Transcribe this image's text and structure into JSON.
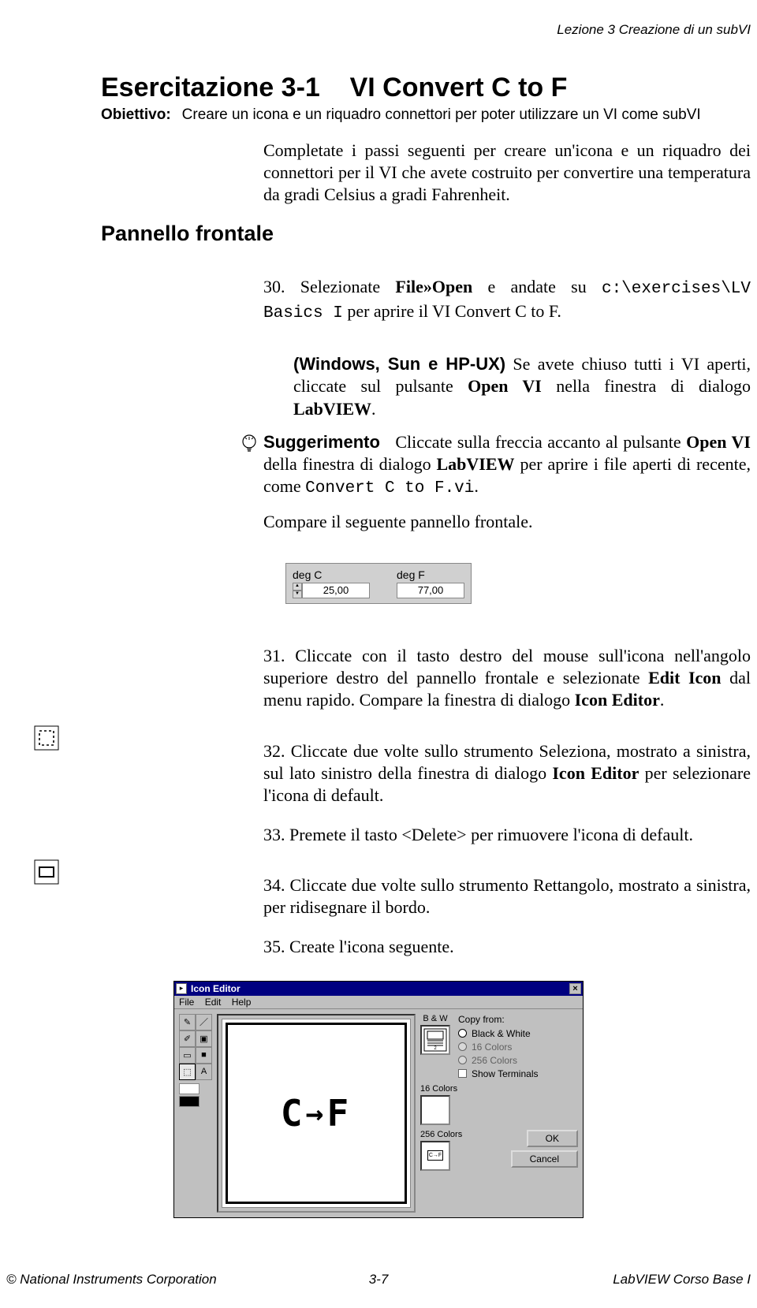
{
  "header": {
    "right": "Lezione 3     Creazione di un subVI"
  },
  "title": {
    "ex": "Esercitazione 3-1",
    "name": "VI Convert C to F"
  },
  "objective": {
    "label": "Obiettivo:",
    "text": "Creare un icona e un riquadro connettori per poter utilizzare un VI come subVI"
  },
  "intro": "Completate i passi seguenti per creare un'icona e un riquadro dei connettori per il VI che avete costruito per convertire una temperatura da gradi Celsius a gradi Fahrenheit.",
  "section_heading": "Pannello frontale",
  "step30": {
    "num": "30.",
    "pre": "Selezionate ",
    "menu": "File»Open",
    "mid": " e andate su ",
    "path": "c:\\exercises\\LV Basics I",
    "post": " per aprire il VI Convert C to F."
  },
  "windows_note": {
    "lead": "(Windows, Sun e HP-UX)",
    "body_pre": " Se avete chiuso tutti i VI aperti, cliccate sul pulsante ",
    "btn": "Open VI",
    "body_mid": " nella finestra di dialogo ",
    "dlg": "LabVIEW",
    "body_post": "."
  },
  "tip": {
    "label": "Suggerimento",
    "body_pre": "Cliccate sulla freccia accanto al pulsante ",
    "btn": "Open VI",
    "body_mid": " della finestra di dialogo ",
    "dlg": "LabVIEW",
    "body_mid2": " per aprire i file aperti di recente, come ",
    "file": "Convert C to F.vi",
    "body_post": "."
  },
  "appears": "Compare il seguente pannello frontale.",
  "panel": {
    "label_c": "deg C",
    "label_f": "deg F",
    "val_c": "25,00",
    "val_f": "77,00"
  },
  "step31": {
    "num": "31.",
    "pre": "Cliccate con il tasto destro del mouse sull'icona nell'angolo superiore destro del pannello frontale e selezionate ",
    "menu": "Edit Icon",
    "mid": " dal menu rapido. Compare la finestra di dialogo ",
    "dlg": "Icon Editor",
    "post": "."
  },
  "step32": {
    "num": "32.",
    "pre": "Cliccate due volte sullo strumento Seleziona, mostrato a sinistra, sul lato sinistro della finestra di dialogo ",
    "dlg": "Icon Editor",
    "post": " per selezionare l'icona di default."
  },
  "step33": {
    "num": "33.",
    "text": "Premete il tasto <Delete> per rimuovere l'icona di default."
  },
  "step34": {
    "num": "34.",
    "text": "Cliccate due volte sullo strumento Rettangolo, mostrato a sinistra, per ridisegnare il bordo."
  },
  "step35": {
    "num": "35.",
    "text": "Create l'icona seguente."
  },
  "dialog": {
    "title": "Icon Editor",
    "menu": {
      "file": "File",
      "edit": "Edit",
      "help": "Help"
    },
    "canvas_label": "C→F",
    "previews": {
      "bw": "B & W",
      "c16": "16 Colors",
      "c256": "256 Colors",
      "small_text": "C→F"
    },
    "copy_from": {
      "title": "Copy from:",
      "bw": "Black & White",
      "c16": "16 Colors",
      "c256": "256 Colors",
      "show": "Show Terminals"
    },
    "buttons": {
      "ok": "OK",
      "cancel": "Cancel"
    }
  },
  "footer": {
    "left": "© National Instruments Corporation",
    "center": "3-7",
    "right": "LabVIEW Corso Base I"
  }
}
